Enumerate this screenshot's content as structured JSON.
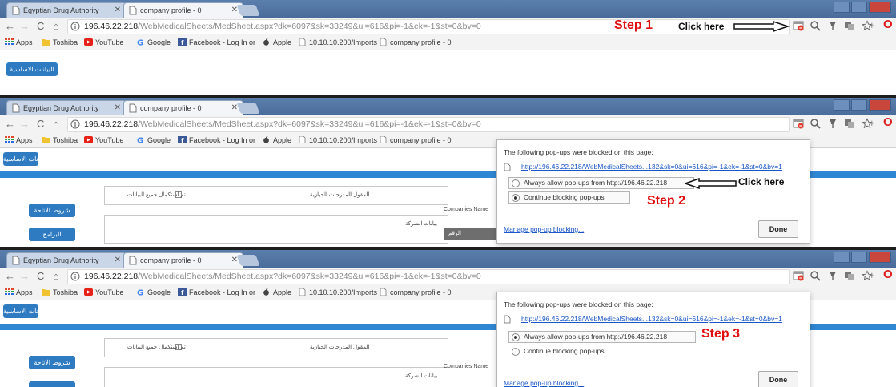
{
  "tabs": {
    "first": "Egyptian Drug Authority",
    "second": "company profile - 0"
  },
  "url": {
    "host": "196.46.22.218",
    "path": "/WebMedicalSheets/MedSheet.aspx?dk=6097&sk=33249&ui=616&pi=-1&ek=-1&st=0&bv=0"
  },
  "toolbar_extra": {
    "plus": "+",
    "opera": "O"
  },
  "bookmarks": [
    "Apps",
    "Toshiba",
    "YouTube",
    "Google",
    "Facebook - Log In or",
    "Apple",
    "10.10.10.200/Imports",
    "company profile - 0"
  ],
  "steps": {
    "step1": "Step 1",
    "step2": "Step 2",
    "step3": "Step 3",
    "click_here": "Click here"
  },
  "page": {
    "basic_data_button": "البيانات الاساسية",
    "terms_button": "شروط الاتاحة",
    "programs_button": "البرامج",
    "all_data_done": "تم استكمال جميع البيانات",
    "commercial_records": "المقول المدرجات الحيازية",
    "company_data": "بيانات الشركة",
    "companies_name": "Companies Name",
    "number_label": "الرقم"
  },
  "popup": {
    "title": "The following pop-ups were blocked on this page:",
    "blocked_link": "http://196.46.22.218/WebMedicalSheets...132&sk=0&ui=616&pi=-1&ek=-1&st=0&bv=1",
    "always_allow": "Always allow pop-ups from http://196.46.22.218",
    "continue_blocking": "Continue blocking pop-ups",
    "manage": "Manage pop-up blocking...",
    "done": "Done"
  },
  "colors": {
    "step_red": "#e01010",
    "button_blue": "#2e7bc2",
    "link_blue": "#1a56c8"
  },
  "icons": [
    "blocked-popup-icon",
    "magnifier-icon",
    "pin-icon",
    "translate-icon",
    "star-icon"
  ]
}
